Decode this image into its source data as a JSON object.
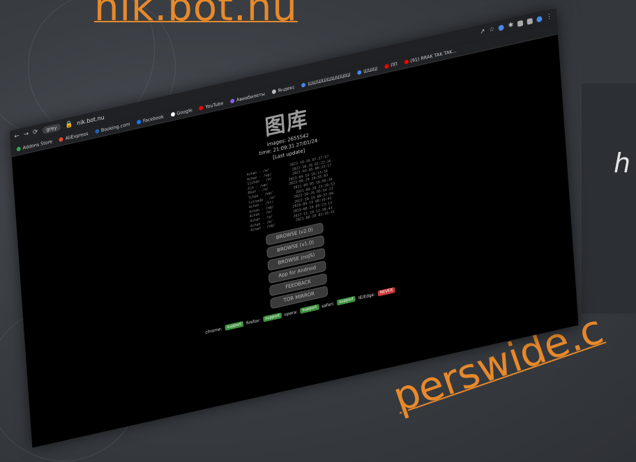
{
  "slide": {
    "top_link": "nik.bot.nu",
    "bottom_link": "perswide.c",
    "side_text": "h"
  },
  "browser": {
    "url": "nik.bot.nu",
    "profile_chip": "grey",
    "bookmarks": [
      {
        "label": "Addons Store",
        "color": "#34a853"
      },
      {
        "label": "AliExpress",
        "color": "#e8492a"
      },
      {
        "label": "Booking.com",
        "color": "#1a5fb4"
      },
      {
        "label": "Facebook",
        "color": "#1877f2"
      },
      {
        "label": "Google",
        "color": "#ffffff"
      },
      {
        "label": "YouTube",
        "color": "#ff0000"
      },
      {
        "label": "Авиабилеты",
        "color": "#8b5cf6"
      },
      {
        "label": "Яндекс",
        "color": "#bbbbbb"
      },
      {
        "label": "ШШШШШШШШШ",
        "color": "#4a86e8"
      },
      {
        "label": "ШШШ",
        "color": "#4a86e8"
      },
      {
        "label": "ПП",
        "color": "#ff0000"
      },
      {
        "label": "(91) RRAK TAK TAK...",
        "color": "#ff0000"
      }
    ]
  },
  "page": {
    "title": "图库",
    "images": "images: 2655542",
    "time": "time: 21:09:31 27/01/24",
    "last_update": "[Last update]",
    "boards": [
      {
        "name": "4chan - /w/",
        "date": "2022-10-26 07:27:57"
      },
      {
        "name": "4chan - /wg/",
        "date": "2022-10-26 01:22:16"
      },
      {
        "name": "11chan - /w/",
        "date": "2021-03-05 00:33:17"
      },
      {
        "name": "2ch - /wp/",
        "date": "2023-04-14 16:14:34"
      },
      {
        "name": "8kun - /w/",
        "date": "2023-09-29 20:55:03"
      },
      {
        "name": "7chan - /wp/",
        "date": "2021-09-05 10:05:34"
      },
      {
        "name": "lolnada - /w/",
        "date": "2021-09-28 23:10:53"
      },
      {
        "name": "4chan - /hr/",
        "date": "2022-10-26 05:54:13"
      },
      {
        "name": "4chan - /wg/",
        "date": "2022-10-19 08:37:09"
      },
      {
        "name": "4chan - /w/",
        "date": "2020-09-19 00:16:41"
      },
      {
        "name": "4chan - /w/",
        "date": "2019-08-19 03:23:13"
      },
      {
        "name": "4chan - /w/",
        "date": "2017-11-18 12:38:43"
      },
      {
        "name": "4chan - /wg/",
        "date": "2021-08-20 03:16:41"
      }
    ],
    "buttons": [
      "BROWSE (v2.0)",
      "BROWSE (v1.0)",
      "BROWSE (noJS)",
      "App for Android",
      "FEEDBACK",
      "TOR MIRROR"
    ],
    "support": [
      {
        "browser": "chrome:",
        "status": "support",
        "ok": true
      },
      {
        "browser": "firefox:",
        "status": "support",
        "ok": true
      },
      {
        "browser": "opera:",
        "status": "support",
        "ok": true
      },
      {
        "browser": "safari:",
        "status": "support",
        "ok": true
      },
      {
        "browser": "IE/Edge:",
        "status": "NEVER",
        "ok": false
      }
    ]
  }
}
